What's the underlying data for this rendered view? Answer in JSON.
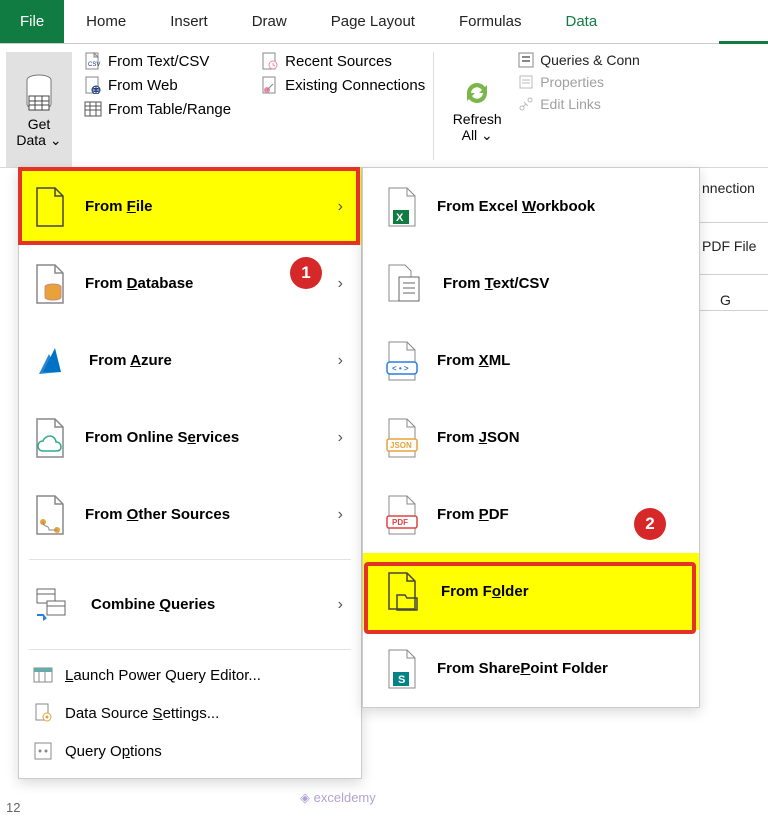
{
  "tabs": {
    "file": "File",
    "home": "Home",
    "insert": "Insert",
    "draw": "Draw",
    "page_layout": "Page Layout",
    "formulas": "Formulas",
    "data": "Data"
  },
  "get_transform": {
    "get_data": "Get\nData",
    "from_text_csv": "From Text/CSV",
    "from_web": "From Web",
    "from_table_range": "From Table/Range",
    "recent_sources": "Recent Sources",
    "existing_connections": "Existing Connections"
  },
  "queries_group": {
    "refresh_all": "Refresh\nAll",
    "queries_connections": "Queries & Conn",
    "properties": "Properties",
    "edit_links": "Edit Links"
  },
  "menu1": {
    "items": [
      "From File",
      "From Database",
      "From Azure",
      "From Online Services",
      "From Other Sources",
      "Combine Queries"
    ],
    "launch_pq": "Launch Power Query Editor...",
    "ds_settings": "Data Source Settings...",
    "query_options": "Query Options"
  },
  "menu2": {
    "items": [
      "From Excel Workbook",
      "From Text/CSV",
      "From XML",
      "From JSON",
      "From PDF",
      "From Folder",
      "From SharePoint Folder"
    ]
  },
  "badges": {
    "b1": "1",
    "b2": "2"
  },
  "behind": {
    "connections_frag": "nnection",
    "pdf_frag": "PDF File",
    "col_g": "G"
  },
  "misc": {
    "rownum": "12",
    "watermark": "exceldemy"
  }
}
